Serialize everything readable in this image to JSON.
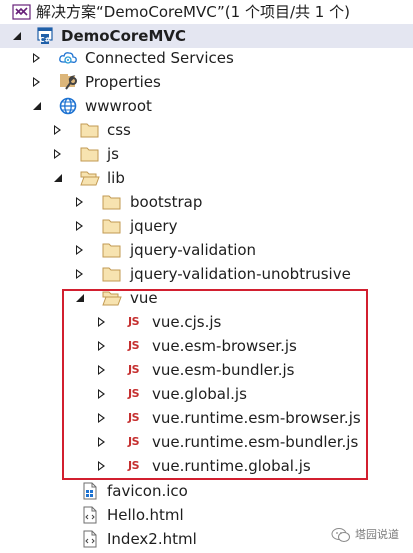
{
  "solution": {
    "label": "解决方案“DemoCoreMVC”(1 个项目/共 1 个)",
    "icon": "solution-icon"
  },
  "project": {
    "label": "DemoCoreMVC",
    "icon": "csharp-project-icon",
    "state": "expanded",
    "selected": true
  },
  "project_children": {
    "connected_services": {
      "label": "Connected Services",
      "icon": "connected-services-icon",
      "state": "collapsed"
    },
    "properties": {
      "label": "Properties",
      "icon": "properties-wrench-icon",
      "state": "collapsed"
    },
    "wwwroot": {
      "label": "wwwroot",
      "icon": "globe-icon",
      "state": "expanded"
    }
  },
  "wwwroot_children": {
    "css": {
      "label": "css",
      "icon": "folder-icon",
      "state": "collapsed"
    },
    "js": {
      "label": "js",
      "icon": "folder-icon",
      "state": "collapsed"
    },
    "lib": {
      "label": "lib",
      "icon": "folder-open-icon",
      "state": "expanded"
    }
  },
  "lib_children": {
    "bootstrap": {
      "label": "bootstrap",
      "icon": "folder-icon",
      "state": "collapsed"
    },
    "jquery": {
      "label": "jquery",
      "icon": "folder-icon",
      "state": "collapsed"
    },
    "jquery_validation": {
      "label": "jquery-validation",
      "icon": "folder-icon",
      "state": "collapsed"
    },
    "jquery_validation_unobtrusive": {
      "label": "jquery-validation-unobtrusive",
      "icon": "folder-icon",
      "state": "collapsed"
    },
    "vue": {
      "label": "vue",
      "icon": "folder-open-icon",
      "state": "expanded"
    }
  },
  "vue_files": {
    "icon_text": "JS",
    "items": [
      "vue.cjs.js",
      "vue.esm-browser.js",
      "vue.esm-bundler.js",
      "vue.global.js",
      "vue.runtime.esm-browser.js",
      "vue.runtime.esm-bundler.js",
      "vue.runtime.global.js"
    ]
  },
  "wwwroot_files": {
    "favicon": {
      "label": "favicon.ico",
      "icon": "favicon-file-icon"
    },
    "hello": {
      "label": "Hello.html",
      "icon": "html-file-icon"
    },
    "index2": {
      "label": "Index2.html",
      "icon": "html-file-icon"
    }
  },
  "colors": {
    "highlight_border": "#d21f2f",
    "selected_row": "#e4e6f1",
    "folder": "#dcb67a",
    "js_icon": "#c52f2f",
    "globe": "#1e73d2"
  },
  "watermark": {
    "text": "塔园说道",
    "icon": "wechat-bubble-icon"
  }
}
